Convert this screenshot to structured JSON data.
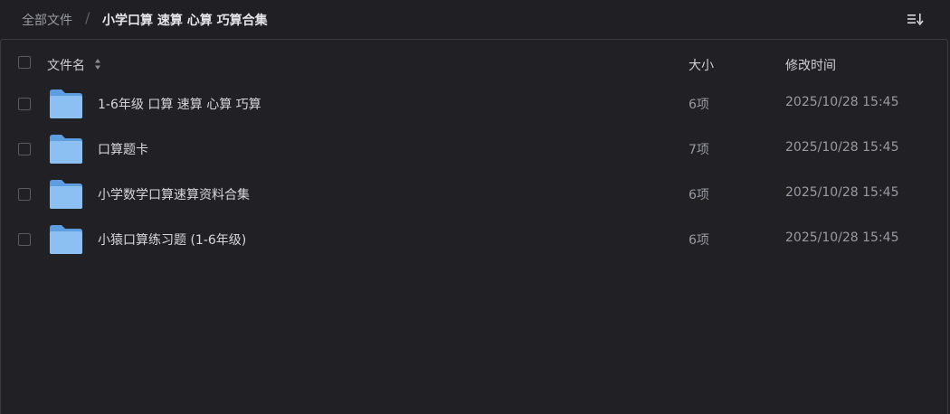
{
  "breadcrumb": {
    "root": "全部文件",
    "separator": "/",
    "current": "小学口算 速算 心算 巧算合集"
  },
  "toolbar": {
    "sort_icon": "sort-list-icon"
  },
  "table": {
    "columns": {
      "name": "文件名",
      "size": "大小",
      "modified": "修改时间"
    },
    "rows": [
      {
        "name": "1-6年级 口算 速算 心算 巧算",
        "size": "6项",
        "modified": "2025/10/28 15:45",
        "icon": "folder-icon"
      },
      {
        "name": "口算题卡",
        "size": "7项",
        "modified": "2025/10/28 15:45",
        "icon": "folder-icon"
      },
      {
        "name": "小学数学口算速算资料合集",
        "size": "6项",
        "modified": "2025/10/28 15:45",
        "icon": "folder-icon"
      },
      {
        "name": "小猿口算练习题 (1-6年级)",
        "size": "6项",
        "modified": "2025/10/28 15:45",
        "icon": "folder-icon"
      }
    ]
  },
  "colors": {
    "background": "#1f1f24",
    "border": "#3a3a40",
    "folder": "#7fb6ee",
    "text_primary": "#d6d6db",
    "text_secondary": "#9a9aa2"
  }
}
